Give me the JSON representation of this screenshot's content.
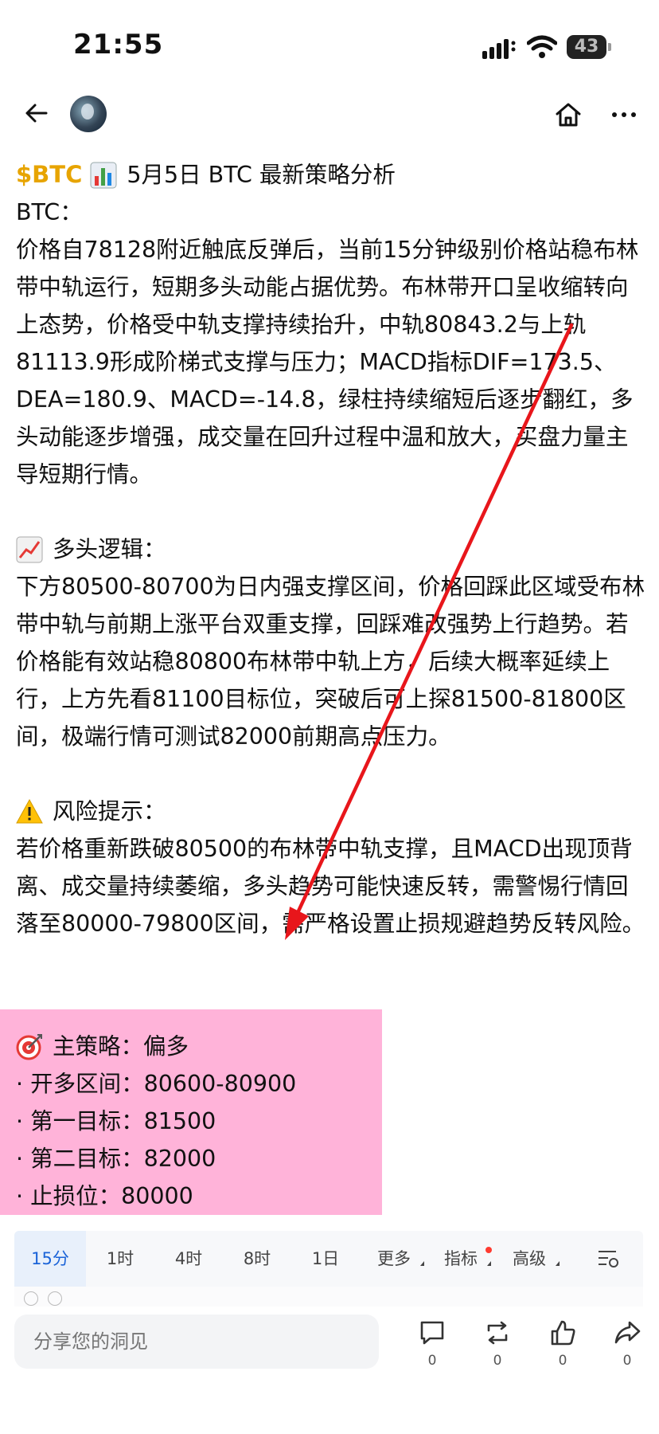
{
  "status_bar": {
    "time": "21:55",
    "battery": "43"
  },
  "post": {
    "ticker": "$BTC",
    "title": "5月5日 BTC 最新策略分析",
    "intro_label": "BTC：",
    "intro": "价格自78128附近触底反弹后，当前15分钟级别价格站稳布林带中轨运行，短期多头动能占据优势。布林带开口呈收缩转向上态势，价格受中轨支撑持续抬升，中轨80843.2与上轨81113.9形成阶梯式支撑与压力；MACD指标DIF=173.5、DEA=180.9、MACD=-14.8，绿柱持续缩短后逐步翻红，多头动能逐步增强，成交量在回升过程中温和放大，买盘力量主导短期行情。",
    "bull_heading": "多头逻辑：",
    "bull_text": "下方80500-80700为日内强支撑区间，价格回踩此区域受布林带中轨与前期上涨平台双重支撑，回踩难改强势上行趋势。若价格能有效站稳80800布林带中轨上方，后续大概率延续上行，上方先看81100目标位，突破后可上探81500-81800区间，极端行情可测试82000前期高点压力。",
    "risk_heading": "风险提示：",
    "risk_text": "若价格重新跌破80500的布林带中轨支撑，且MACD出现顶背离、成交量持续萎缩，多头趋势可能快速反转，需警惕行情回落至80000-79800区间，需严格设置止损规避趋势反转风险。",
    "strategy": {
      "heading": "主策略：偏多",
      "rows": [
        "· 开多区间：80600-80900",
        "· 第一目标：81500",
        "· 第二目标：82000",
        "· 止损位：80000"
      ]
    }
  },
  "timeframes": [
    "15分",
    "1时",
    "4时",
    "8时",
    "1日",
    "更多",
    "指标",
    "高级"
  ],
  "bottom_bar": {
    "input_placeholder": "分享您的洞见",
    "comment_count": "0",
    "repost_count": "0",
    "like_count": "0",
    "share_count": "0"
  },
  "colors": {
    "accent": "#1a63d8",
    "ticker": "#e7a400",
    "highlight": "#ffb3d9",
    "arrow": "#e8161b"
  },
  "icons": [
    "back-icon",
    "home-icon",
    "more-icon",
    "chart-emoji-icon",
    "trend-up-emoji-icon",
    "warning-emoji-icon",
    "target-emoji-icon",
    "comment-icon",
    "repost-icon",
    "like-icon",
    "share-icon"
  ]
}
